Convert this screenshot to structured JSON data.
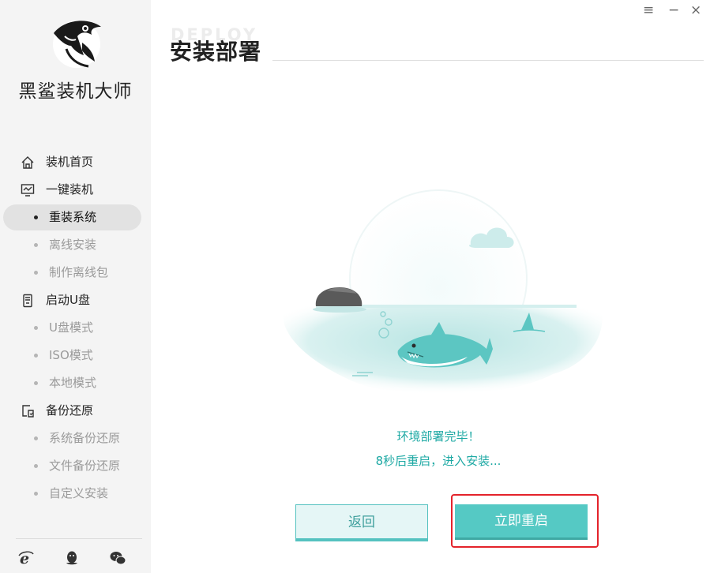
{
  "app": {
    "brand_name": "黑鲨装机大师",
    "logo_icon": "shark-logo-icon"
  },
  "window_controls": {
    "menu": "≡",
    "minimize": "−",
    "close": "×"
  },
  "sidebar": {
    "items": [
      {
        "type": "group",
        "label": "装机首页",
        "icon": "home-icon"
      },
      {
        "type": "group",
        "label": "一键装机",
        "icon": "monitor-icon"
      },
      {
        "type": "sub",
        "label": "重装系统",
        "active": true
      },
      {
        "type": "sub",
        "label": "离线安装"
      },
      {
        "type": "sub",
        "label": "制作离线包"
      },
      {
        "type": "group",
        "label": "启动U盘",
        "icon": "usb-drive-icon"
      },
      {
        "type": "sub",
        "label": "U盘模式"
      },
      {
        "type": "sub",
        "label": "ISO模式"
      },
      {
        "type": "sub",
        "label": "本地模式"
      },
      {
        "type": "group",
        "label": "备份还原",
        "icon": "backup-icon"
      },
      {
        "type": "sub",
        "label": "系统备份还原"
      },
      {
        "type": "sub",
        "label": "文件备份还原"
      },
      {
        "type": "sub",
        "label": "自定义安装"
      }
    ],
    "footer_icons": [
      "ie-browser-icon",
      "qq-penguin-icon",
      "wechat-icon"
    ]
  },
  "header": {
    "title": "安装部署",
    "ghost_text": "DEPLOY"
  },
  "main": {
    "status_line1": "环境部署完毕！",
    "status_line2": "8秒后重启，进入安装...",
    "back_button": "返回",
    "restart_button": "立即重启"
  },
  "colors": {
    "accent": "#55c9c4",
    "accent_text": "#1ea9a4",
    "highlight_box": "#e4232b",
    "sidebar_bg": "#f4f4f4"
  }
}
